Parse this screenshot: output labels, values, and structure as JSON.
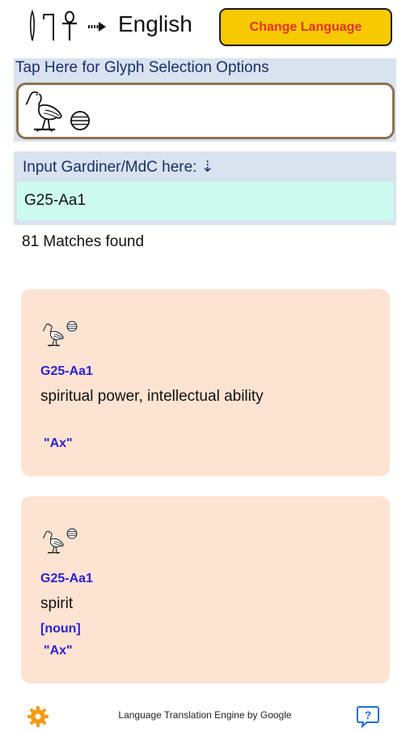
{
  "header": {
    "target_language": "English",
    "change_language_label": "Change Language",
    "icons": [
      "hieroglyph-tools-icon",
      "arrow-right-icon"
    ]
  },
  "glyph_panel": {
    "title": "Tap Here for Glyph Selection Options",
    "selected_glyphs": [
      "G25",
      "Aa1"
    ]
  },
  "gardiner_input": {
    "label": "Input Gardiner/MdC here: ⇣",
    "value": "G25-Aa1"
  },
  "matches_text": "81 Matches found",
  "results": [
    {
      "code": "G25-Aa1",
      "meaning": "spiritual power, intellectual ability",
      "part_of_speech": "",
      "transliteration": "\"Ax\""
    },
    {
      "code": "G25-Aa1",
      "meaning": "spirit",
      "part_of_speech": "[noun]",
      "transliteration": "\"Ax\""
    }
  ],
  "footer": {
    "credit": "Language Translation Engine by Google",
    "settings_icon": "gear-icon",
    "help_icon": "help-bubble-icon"
  },
  "colors": {
    "button_bg": "#f7c900",
    "button_text": "#e8312a",
    "panel_bg": "#d8e3ef",
    "input_bg": "#cdfaee",
    "card_bg": "#fde3d2",
    "accent_blue": "#2b1fd6",
    "gear_orange": "#f39c12",
    "help_blue": "#1e6fd9"
  }
}
